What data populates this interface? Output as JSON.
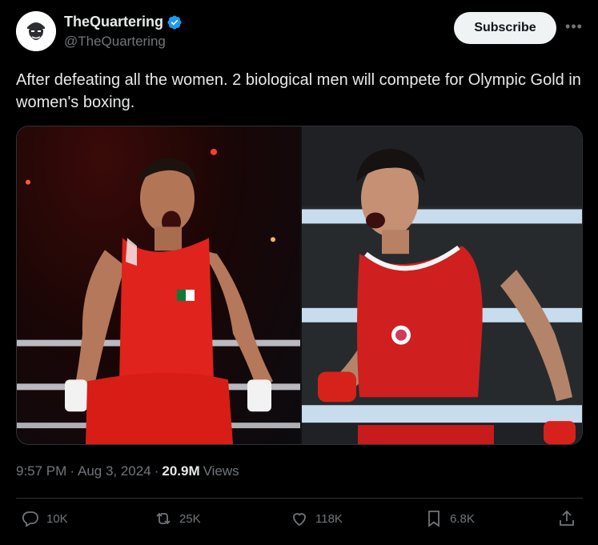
{
  "author": {
    "display_name": "TheQuartering",
    "handle": "@TheQuartering",
    "verified": true
  },
  "subscribe_label": "Subscribe",
  "more_label": "•••",
  "tweet": {
    "text": "After defeating all the women. 2 biological men will compete for Olympic Gold in women's boxing."
  },
  "meta": {
    "time": "9:57 PM",
    "sep1": "·",
    "date": "Aug 3, 2024",
    "sep2": "·",
    "views_count": "20.9M",
    "views_label": "Views"
  },
  "actions": {
    "replies": "10K",
    "reposts": "25K",
    "likes": "118K",
    "bookmarks": "6.8K"
  },
  "colors": {
    "background": "#000000",
    "text": "#e7e9ea",
    "muted": "#71767b",
    "verified": "#1d9bf0",
    "subscribe_bg": "#eff3f4"
  },
  "icons": [
    "more-icon",
    "verified-badge-icon",
    "reply-icon",
    "repost-icon",
    "like-icon",
    "bookmark-icon",
    "share-icon"
  ]
}
